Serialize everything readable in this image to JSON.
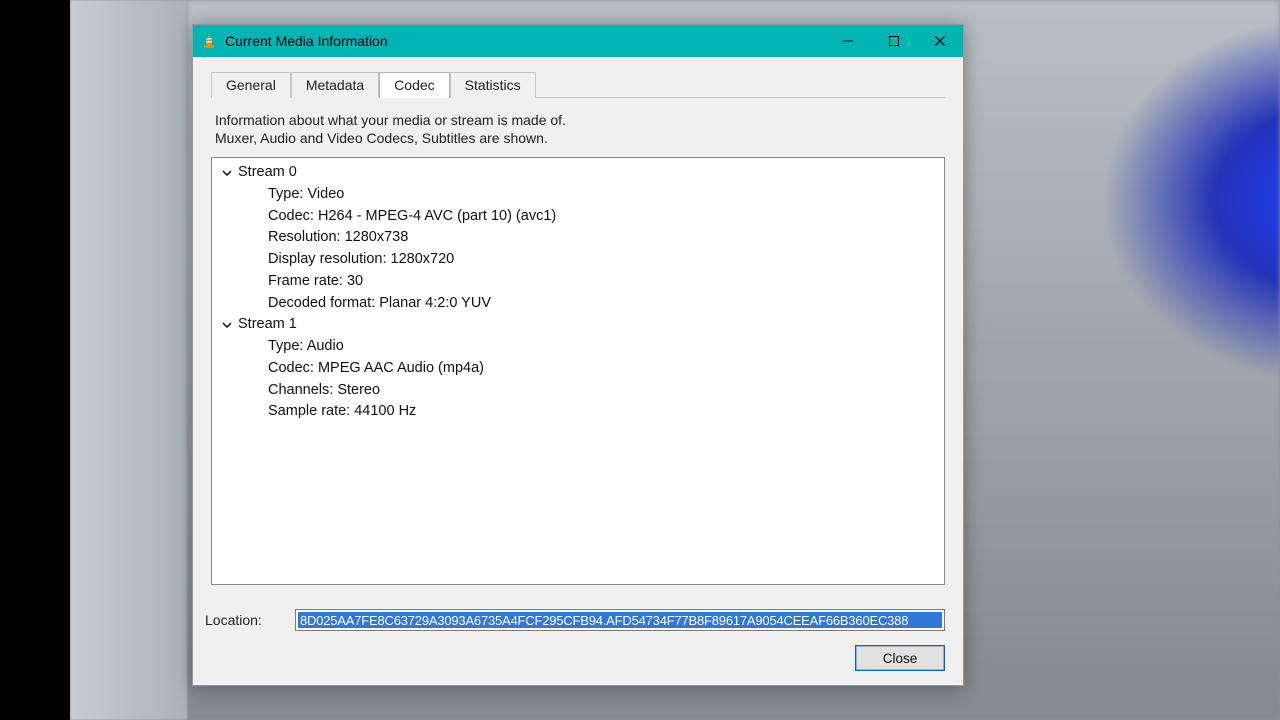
{
  "dialog": {
    "title": "Current Media Information"
  },
  "tabs": {
    "general": "General",
    "metadata": "Metadata",
    "codec": "Codec",
    "statistics": "Statistics",
    "active": "codec"
  },
  "codec_panel": {
    "info_line1": "Information about what your media or stream is made of.",
    "info_line2": "Muxer, Audio and Video Codecs, Subtitles are shown.",
    "streams": [
      {
        "name": "Stream 0",
        "rows": [
          "Type: Video",
          "Codec: H264 - MPEG-4 AVC (part 10) (avc1)",
          "Resolution: 1280x738",
          "Display resolution: 1280x720",
          "Frame rate: 30",
          "Decoded format: Planar 4:2:0 YUV"
        ]
      },
      {
        "name": "Stream 1",
        "rows": [
          "Type: Audio",
          "Codec: MPEG AAC Audio (mp4a)",
          "Channels: Stereo",
          "Sample rate: 44100 Hz"
        ]
      }
    ]
  },
  "location": {
    "label": "Location:",
    "value": "8D025AA7FE8C63729A3093A6735A4FCF295CFB94.AFD54734F77B8F89617A9054CEEAF66B360EC388"
  },
  "buttons": {
    "close": "Close"
  }
}
